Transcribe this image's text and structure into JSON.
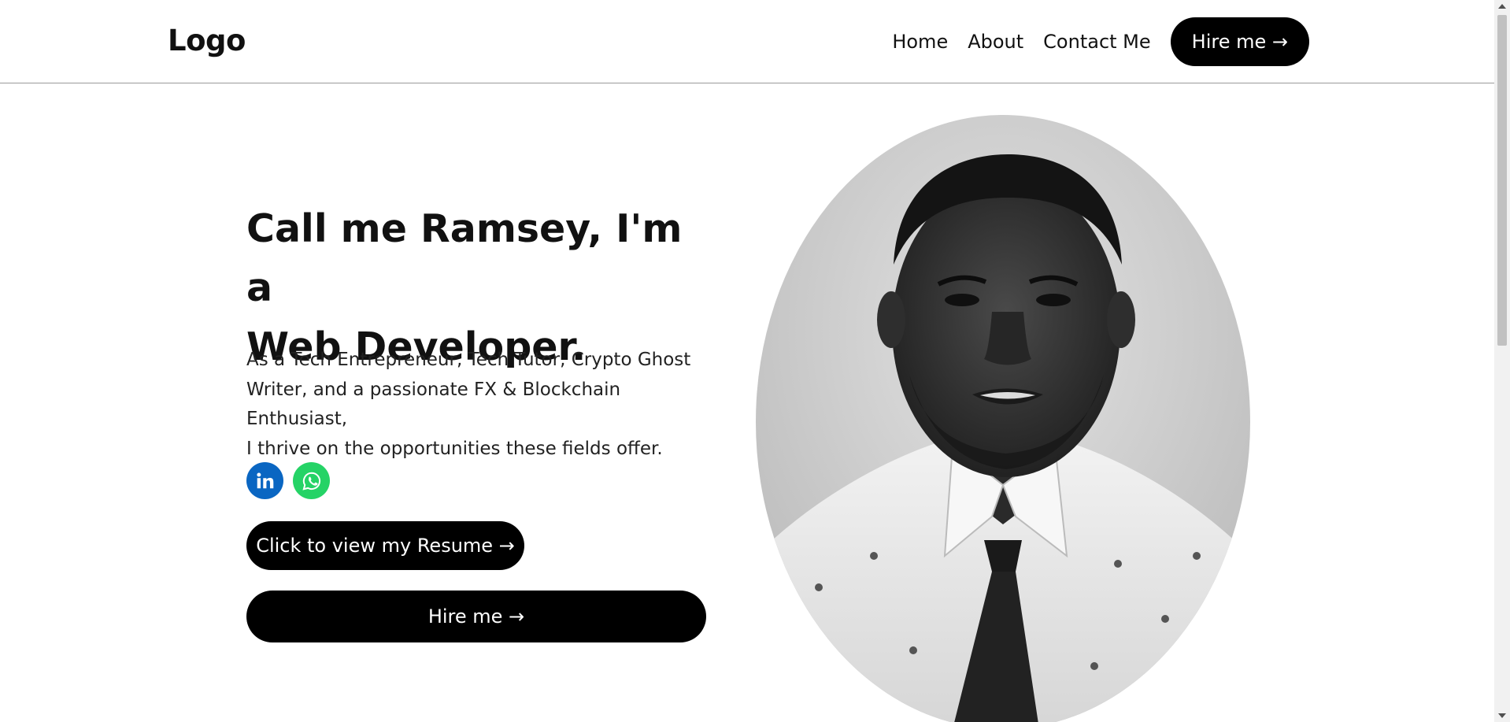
{
  "header": {
    "logo": "Logo",
    "nav": [
      "Home",
      "About",
      "Contact Me"
    ],
    "hire_label": "Hire me →"
  },
  "hero": {
    "title_line1": "Call me Ramsey, I'm a",
    "title_line2": "Web Developer.",
    "desc_line1": "As a Tech Entrepreneur, Tech Tutor, Crypto Ghost",
    "desc_line2": "Writer, and a passionate FX & Blockchain Enthusiast,",
    "desc_line3": "I thrive on the opportunities these fields offer.",
    "socials": [
      {
        "icon": "linkedin-icon",
        "color": "#0a66c2"
      },
      {
        "icon": "whatsapp-icon",
        "color": "#25d366"
      }
    ],
    "resume_label": "Click to view my Resume →",
    "hire_label": "Hire me →"
  },
  "portrait": {
    "icon": "portrait-photo"
  },
  "colors": {
    "primary": "#000000",
    "background": "#ffffff",
    "divider": "#9a9a9a"
  }
}
